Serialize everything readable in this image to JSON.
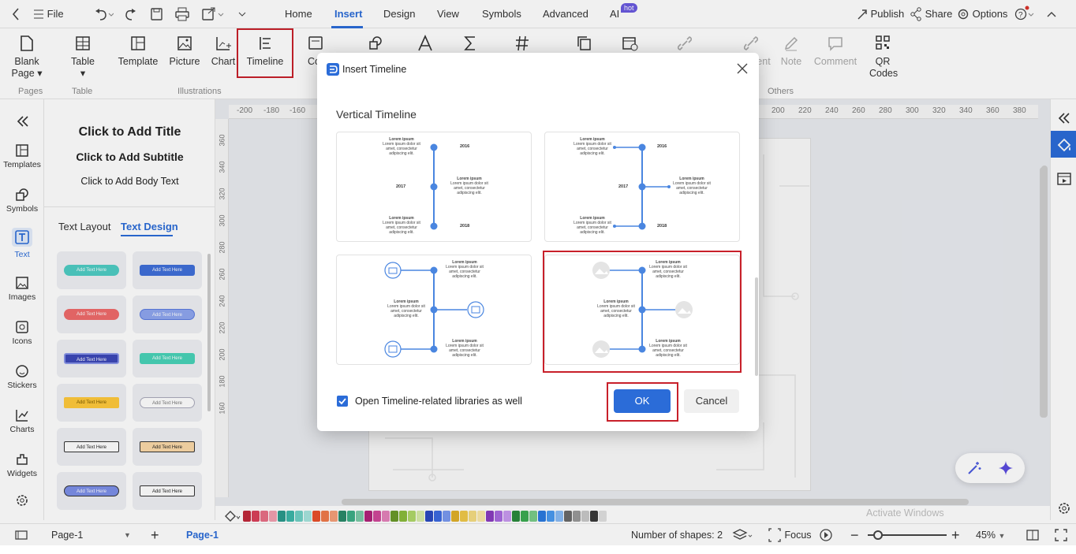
{
  "topbar": {
    "file": "File",
    "tabs": [
      "Home",
      "Insert",
      "Design",
      "View",
      "Symbols",
      "Advanced",
      "AI"
    ],
    "hot_badge": "hot",
    "publish": "Publish",
    "share": "Share",
    "options": "Options"
  },
  "ribbon": {
    "buttons": {
      "blank_page": "Blank Page",
      "table": "Table",
      "template": "Template",
      "picture": "Picture",
      "chart": "Chart",
      "timeline": "Timeline",
      "co_partial": "Co",
      "note": "Note",
      "comment": "Comment",
      "qr_codes": "QR Codes",
      "ent_partial": "ent"
    },
    "groups": {
      "pages": "Pages",
      "table": "Table",
      "illustrations": "Illustrations",
      "others": "Others"
    }
  },
  "leftnav": [
    "Templates",
    "Symbols",
    "Text",
    "Images",
    "Icons",
    "Stickers",
    "Charts",
    "Widgets"
  ],
  "panel": {
    "title": "Click to Add Title",
    "subtitle": "Click to Add Subtitle",
    "body": "Click to Add Body Text",
    "tab_layout": "Text Layout",
    "tab_design": "Text Design",
    "tile_text": "Add Text Here"
  },
  "ruler_x": [
    "-200",
    "-180",
    "-160",
    "200",
    "220",
    "240",
    "260",
    "280",
    "300",
    "320",
    "340",
    "360",
    "380"
  ],
  "ruler_y": [
    "360",
    "340",
    "320",
    "300",
    "280",
    "260",
    "240",
    "220",
    "200",
    "180",
    "160"
  ],
  "dialog": {
    "title": "Insert Timeline",
    "section": "Vertical Timeline",
    "card_heading": "Lorem ipsum",
    "card_body": "Lorem ipsum dolor sit amet, consectetur adipiscing elit.",
    "years": [
      "2016",
      "2017",
      "2018"
    ],
    "checkbox_label": "Open Timeline-related libraries as well",
    "checkbox_checked": true,
    "ok": "OK",
    "cancel": "Cancel"
  },
  "statusbar": {
    "page_select": "Page-1",
    "page_tab": "Page-1",
    "shapes": "Number of shapes: 2",
    "focus": "Focus",
    "zoom": "45%",
    "watermark": "Activate Windows"
  },
  "colors": {
    "accent": "#2b6cd8",
    "highlight": "#c8202a",
    "timeline_blue": "#4a86e0"
  }
}
